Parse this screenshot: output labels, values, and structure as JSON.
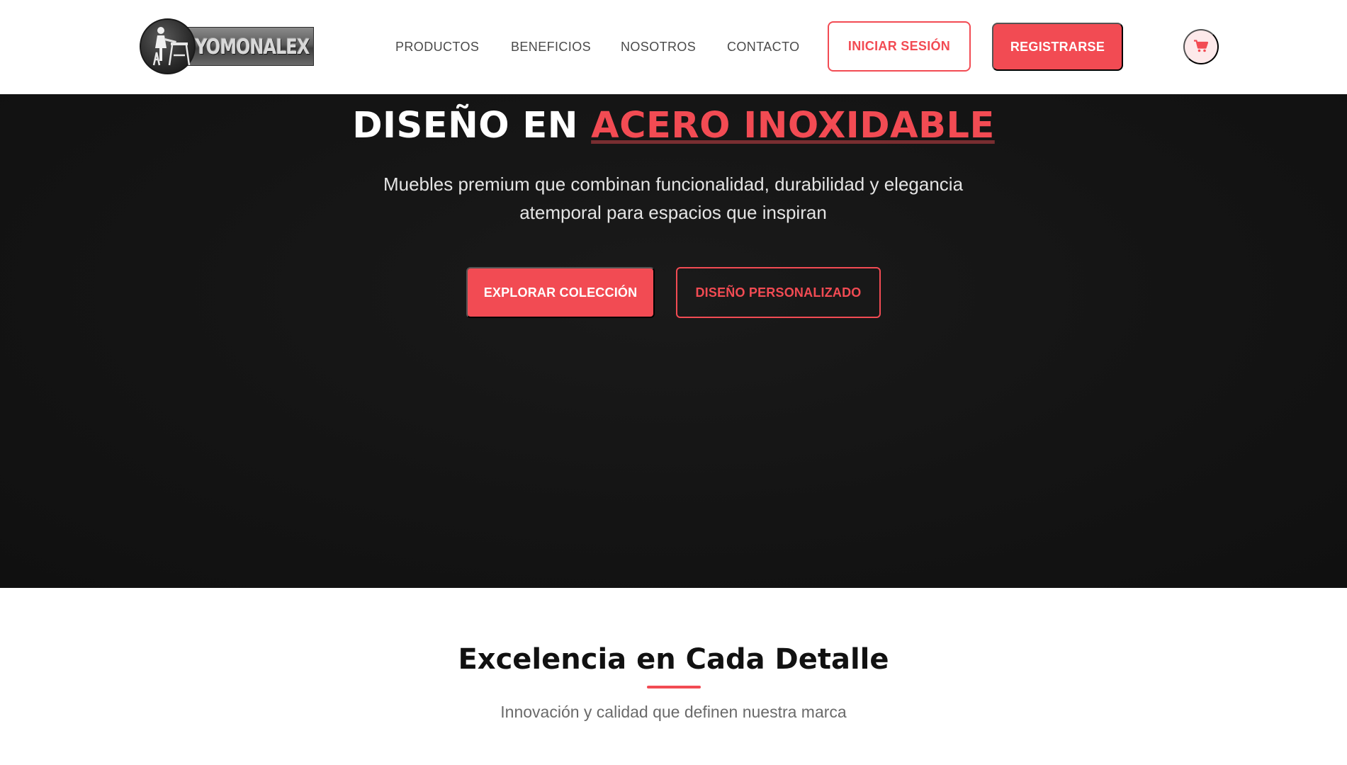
{
  "brand": {
    "name": "YOMONALEX",
    "accent_color": "#f24b53",
    "hero_bg_color": "#141414"
  },
  "nav": {
    "items": [
      {
        "label": "PRODUCTOS"
      },
      {
        "label": "BENEFICIOS"
      },
      {
        "label": "NOSOTROS"
      },
      {
        "label": "CONTACTO"
      }
    ],
    "login_label": "INICIAR SESIÓN",
    "register_label": "REGISTRARSE",
    "cart_icon": "cart-icon"
  },
  "hero": {
    "title_main": "DISEÑO EN ",
    "title_accent": "ACERO INOXIDABLE",
    "subtitle": "Muebles premium que combinan funcionalidad, durabilidad y elegancia atemporal para espacios que inspiran",
    "primary_button": "EXPLORAR COLECCIÓN",
    "secondary_button": "DISEÑO PERSONALIZADO"
  },
  "section": {
    "title": "Excelencia en Cada Detalle",
    "subtitle": "Innovación y calidad que definen nuestra marca"
  }
}
